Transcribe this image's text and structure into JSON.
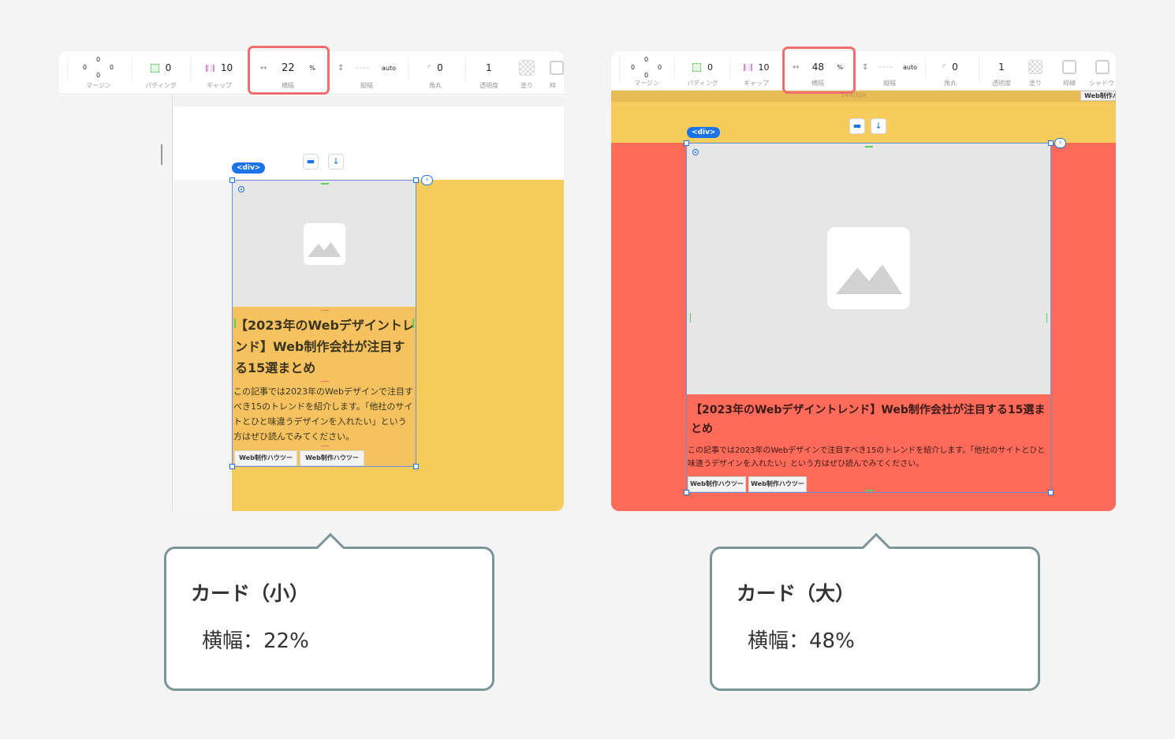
{
  "left": {
    "toolbar": {
      "margin": {
        "top": "0",
        "left": "0",
        "right": "0",
        "bottom": "0",
        "label": "マージン"
      },
      "padding": {
        "value": "0",
        "label": "パディング"
      },
      "gap": {
        "value": "10",
        "label": "ギャップ"
      },
      "width": {
        "icon": "↔",
        "value": "22",
        "unit": "%",
        "label": "横幅"
      },
      "height": {
        "icon": "↕",
        "dashes": "----",
        "auto": "auto",
        "label": "縦幅"
      },
      "radius": {
        "icon": "◜",
        "value": "0",
        "label": "角丸"
      },
      "opacity": {
        "value": "1",
        "label": "透明度"
      },
      "fill": {
        "label": "塗り"
      },
      "border": {
        "label": "枠"
      }
    },
    "canvas": {
      "tag": "<div>",
      "card": {
        "title": "【2023年のWebデザイントレンド】Web制作会社が注目する15選まとめ",
        "description": "この記事では2023年のWebデザインで注目すべき15のトレンドを紹介します。「他社のサイトとひと味違うデザインを入れたい」という方はぜひ読んでみてください。",
        "tags": [
          "Web制作ハウツー",
          "Web制作ハウツー"
        ]
      }
    }
  },
  "right": {
    "toolbar": {
      "margin": {
        "top": "0",
        "left": "0",
        "right": "0",
        "bottom": "0",
        "label": "マージン"
      },
      "padding": {
        "value": "0",
        "label": "パディング"
      },
      "gap": {
        "value": "10",
        "label": "ギャップ"
      },
      "width": {
        "icon": "↔",
        "value": "48",
        "unit": "%",
        "label": "横幅"
      },
      "height": {
        "icon": "↕",
        "dashes": "----",
        "auto": "auto",
        "label": "縦幅"
      },
      "radius": {
        "icon": "◜",
        "value": "0",
        "label": "角丸"
      },
      "opacity": {
        "value": "1",
        "label": "透明度"
      },
      "fill": {
        "label": "塗り"
      },
      "border": {
        "label": "枠線"
      },
      "shadow": {
        "label": "シャドウ"
      }
    },
    "canvas": {
      "px_label": "1440px",
      "corner_tag": "Web制作ハ",
      "tag": "<div>",
      "card": {
        "title": "【2023年のWebデザイントレンド】Web制作会社が注目する15選まとめ",
        "description": "この記事では2023年のWebデザインで注目すべき15のトレンドを紹介します。「他社のサイトとひと味違うデザインを入れたい」という方はぜひ読んでみてください。",
        "tags": [
          "Web制作ハウツー",
          "Web制作ハウツー"
        ]
      }
    }
  },
  "callouts": {
    "small": {
      "title": "カード（小）",
      "body": "横幅：22%"
    },
    "large": {
      "title": "カード（大）",
      "body": "横幅：48%"
    }
  },
  "colors": {
    "yellow": "#f6cc5c",
    "coral": "#ff6b5b",
    "highlight": "#f06e6e",
    "accent_blue": "#1a73e8",
    "callout_border": "#7b949a"
  }
}
